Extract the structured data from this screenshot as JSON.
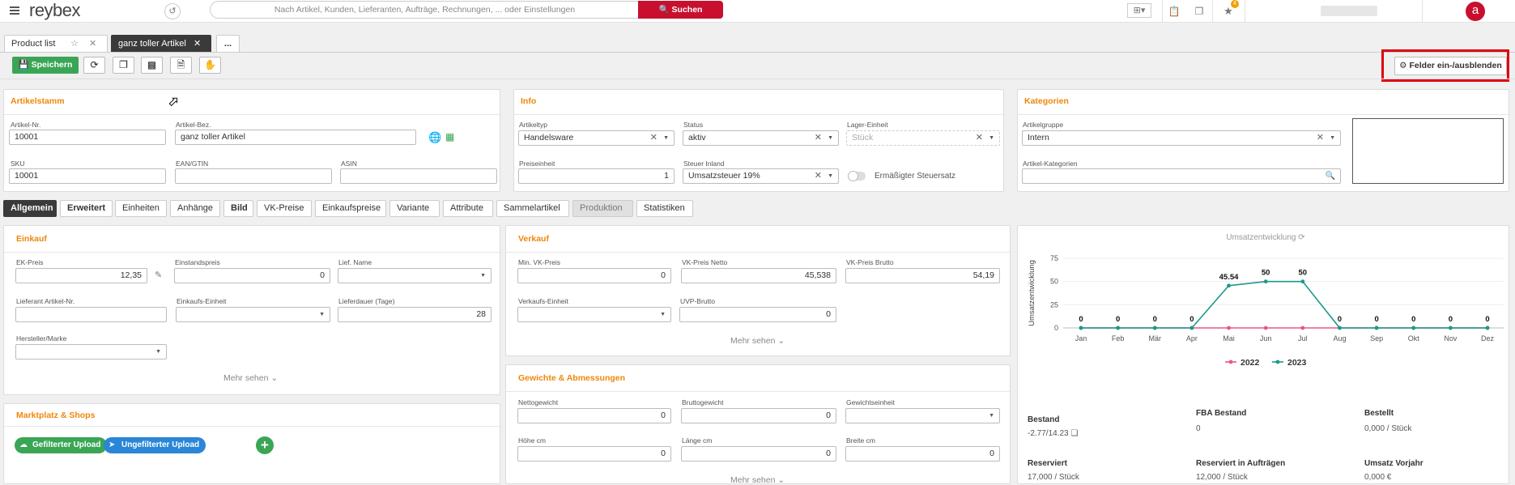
{
  "topbar": {
    "logo": "reybex",
    "search_placeholder": "Nach Artikel, Kunden, Lieferanten, Aufträge, Rechnungen, ... oder Einstellungen",
    "search_button": "Suchen",
    "notification_count": "4",
    "avatar_letter": "a"
  },
  "tabs": [
    {
      "label": "Product list"
    },
    {
      "label": "ganz toller Artikel"
    },
    {
      "label": "..."
    }
  ],
  "toolbar": {
    "save_label": "Speichern",
    "fields_toggle_label": "Felder ein-/ausblenden"
  },
  "artikelstamm": {
    "title": "Artikelstamm",
    "artikel_nr_label": "Artikel-Nr.",
    "artikel_nr": "10001",
    "artikel_bez_label": "Artikel-Bez.",
    "artikel_bez": "ganz toller Artikel",
    "sku_label": "SKU",
    "sku": "10001",
    "ean_label": "EAN/GTIN",
    "ean": "",
    "asin_label": "ASIN",
    "asin": ""
  },
  "info": {
    "title": "Info",
    "artikeltyp_label": "Artikeltyp",
    "artikeltyp": "Handelsware",
    "status_label": "Status",
    "status": "aktiv",
    "lager_label": "Lager-Einheit",
    "lager_placeholder": "Stück",
    "preiseinheit_label": "Preiseinheit",
    "preiseinheit": "1",
    "steuer_label": "Steuer Inland",
    "steuer": "Umsatzsteuer 19%",
    "ermaessigt_label": "Ermäßigter Steuersatz"
  },
  "kategorien": {
    "title": "Kategorien",
    "artikelgruppe_label": "Artikelgruppe",
    "artikelgruppe": "Intern",
    "kategorien_label": "Artikel-Kategorien"
  },
  "detail_tabs": [
    {
      "label": "Allgemein"
    },
    {
      "label": "Erweitert"
    },
    {
      "label": "Einheiten"
    },
    {
      "label": "Anhänge"
    },
    {
      "label": "Bild"
    },
    {
      "label": "VK-Preise"
    },
    {
      "label": "Einkaufspreise"
    },
    {
      "label": "Variante"
    },
    {
      "label": "Attribute"
    },
    {
      "label": "Sammelartikel"
    },
    {
      "label": "Produktion"
    },
    {
      "label": "Statistiken"
    }
  ],
  "einkauf": {
    "title": "Einkauf",
    "ek_preis_label": "EK-Preis",
    "ek_preis": "12,35",
    "einstandspreis_label": "Einstandspreis",
    "einstandspreis": "0",
    "lief_name_label": "Lief. Name",
    "lief_artikel_label": "Lieferant Artikel-Nr.",
    "einkaufseinheit_label": "Einkaufs-Einheit",
    "lieferdauer_label": "Lieferdauer (Tage)",
    "lieferdauer": "28",
    "hersteller_label": "Hersteller/Marke",
    "mehr": "Mehr sehen"
  },
  "verkauf": {
    "title": "Verkauf",
    "min_vk_label": "Min. VK-Preis",
    "min_vk": "0",
    "vk_netto_label": "VK-Preis Netto",
    "vk_netto": "45,538",
    "vk_brutto_label": "VK-Preis Brutto",
    "vk_brutto": "54,19",
    "verkaufseinheit_label": "Verkaufs-Einheit",
    "uvp_label": "UVP-Brutto",
    "uvp": "0",
    "mehr": "Mehr sehen"
  },
  "gewichte": {
    "title": "Gewichte & Abmessungen",
    "netto_label": "Nettogewicht",
    "netto": "0",
    "brutto_label": "Bruttogewicht",
    "brutto": "0",
    "einheit_label": "Gewichtseinheit",
    "hoehe_label": "Höhe cm",
    "hoehe": "0",
    "laenge_label": "Länge cm",
    "laenge": "0",
    "breite_label": "Breite cm",
    "breite": "0",
    "mehr": "Mehr sehen"
  },
  "marktplatz": {
    "title": "Marktplatz & Shops",
    "gefiltert": "Gefilterter Upload",
    "ungefiltert": "Ungefilterter Upload"
  },
  "chart_data": {
    "type": "line",
    "title": "Umsatzentwicklung",
    "ylabel": "Umsatzentwicklung",
    "categories": [
      "Jan",
      "Feb",
      "Mär",
      "Apr",
      "Mai",
      "Jun",
      "Jul",
      "Aug",
      "Sep",
      "Okt",
      "Nov",
      "Dez"
    ],
    "yticks": [
      0,
      25,
      50,
      75
    ],
    "ylim": [
      0,
      75
    ],
    "series": [
      {
        "name": "2022",
        "color": "#e8568a",
        "values": [
          0,
          0,
          0,
          0,
          0,
          0,
          0,
          0,
          0,
          0,
          0,
          0
        ]
      },
      {
        "name": "2023",
        "color": "#1a9a8a",
        "values": [
          0,
          0,
          0,
          0,
          45.54,
          50,
          50,
          0,
          0,
          0,
          0,
          0
        ]
      }
    ],
    "data_labels": [
      "0",
      "0",
      "0",
      "0",
      "45.54",
      "50",
      "50",
      "0",
      "0",
      "0",
      "0",
      "0"
    ],
    "legend": "bottom"
  },
  "stats": {
    "bestand_label": "Bestand",
    "bestand": "-2.77/14.23",
    "fba_label": "FBA Bestand",
    "fba": "0",
    "bestellt_label": "Bestellt",
    "bestellt": "0,000 / Stück",
    "reserviert_label": "Reserviert",
    "reserviert": "17,000 / Stück",
    "res_auftraege_label": "Reserviert in Aufträgen",
    "res_auftraege": "12,000 / Stück",
    "umsatz_label": "Umsatz Vorjahr",
    "umsatz": "0,000 €"
  }
}
